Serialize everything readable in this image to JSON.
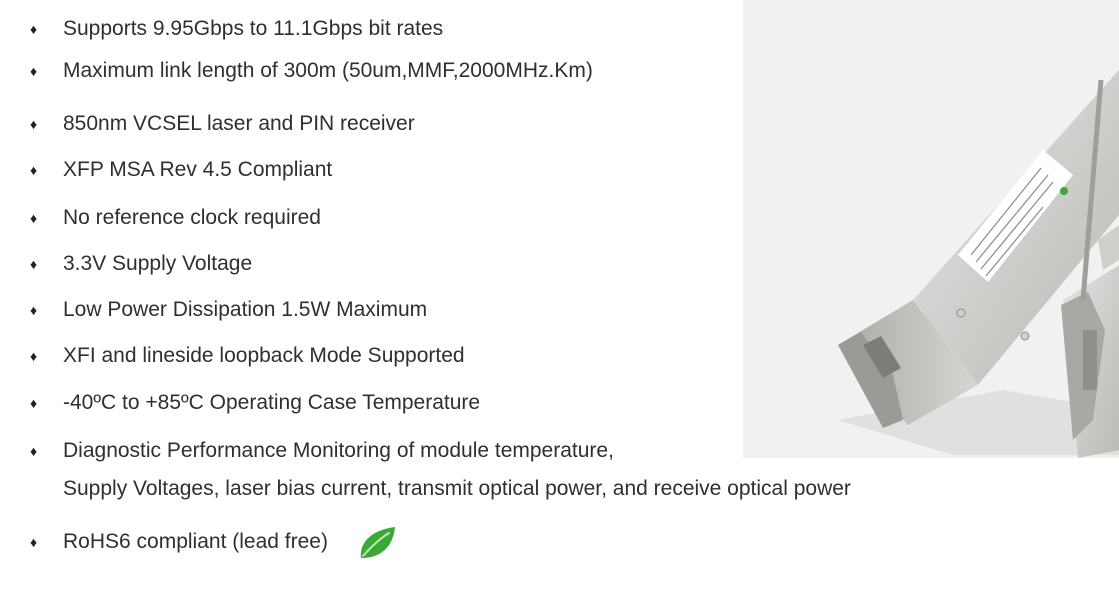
{
  "features": [
    {
      "text": "Supports 9.95Gbps to 11.1Gbps bit rates"
    },
    {
      "text": "Maximum link length of 300m (50um,MMF,2000MHz.Km)"
    },
    {
      "text": "850nm VCSEL laser and PIN receiver"
    },
    {
      "text": "XFP MSA Rev 4.5 Compliant"
    },
    {
      "text": "No reference clock required"
    },
    {
      "text": "3.3V Supply Voltage"
    },
    {
      "text": "Low Power Dissipation 1.5W Maximum"
    },
    {
      "text": "XFI and lineside loopback Mode Supported"
    },
    {
      "text": "-40ºC to +85ºC Operating Case Temperature"
    },
    {
      "text": "Diagnostic Performance Monitoring of module temperature,",
      "continuation": "Supply Voltages, laser bias current, transmit optical power, and receive optical power"
    },
    {
      "text": "RoHS6 compliant (lead free)",
      "icon": "leaf-icon"
    }
  ],
  "bullet_glyph": "♦",
  "colors": {
    "text": "#2f2f2f",
    "photo_background": "#f1f1f0",
    "leaf": "#3aaa35"
  }
}
